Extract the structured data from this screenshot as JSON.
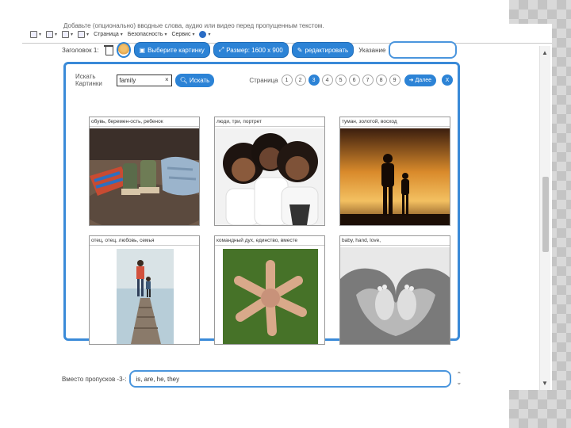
{
  "toolbar": {
    "page_menu": "Страница",
    "security_menu": "Безопасность",
    "service_menu": "Сервис"
  },
  "intro_text": "Добавьте (опционально) вводные слова, аудио или видео перед пропущенным текстом.",
  "heading": {
    "label": "Заголовок 1:",
    "choose_picture": "Выберите картинку",
    "size": "Размер: 1600 x 900",
    "edit": "редактировать",
    "hint_label": "Указание"
  },
  "dialog": {
    "search_label": "Искать Картинки",
    "search_value": "family",
    "search_button": "Искать",
    "page_label": "Страница",
    "pages": [
      "1",
      "2",
      "3",
      "4",
      "5",
      "6",
      "7",
      "8",
      "9"
    ],
    "active_page": "3",
    "next_button": "Далее",
    "close_button": "X",
    "images": [
      {
        "tags": "обувь, беремен-ость, ребенок"
      },
      {
        "tags": "люди, три, портрет"
      },
      {
        "tags": "туман, золотой, восход"
      },
      {
        "tags": "отец, отец, любовь, семья"
      },
      {
        "tags": "командный дух, единство, вместе"
      },
      {
        "tags": "baby, hand, love,"
      }
    ]
  },
  "blanks": {
    "label": "Вместо пропусков -3-:",
    "value": "is, are, he, they"
  },
  "colors": {
    "accent": "#2c83d6",
    "border": "#3a8ad8"
  }
}
